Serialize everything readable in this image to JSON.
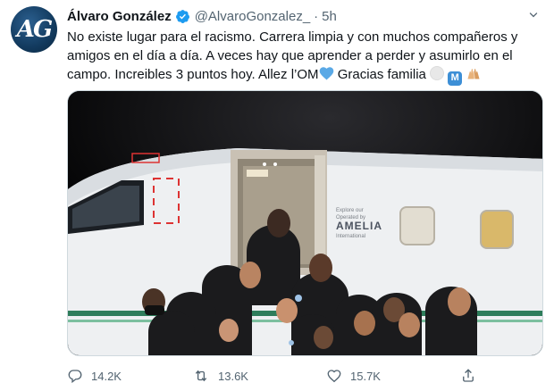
{
  "author": {
    "name": "Álvaro González",
    "handle": "@AlvaroGonzalez_",
    "separator": "·",
    "time": "5h",
    "avatar_initials": "AG"
  },
  "tweet": {
    "text_line1": "No existe lugar para el racismo. Carrera limpia y con muchos compañeros y",
    "text_line2": "amigos en el día a día. A veces hay que aprender a perder y asumirlo en el",
    "text_line3": "campo. Increibles 3 puntos hoy. Allez l’OM",
    "text_line3b": " Gracias familia",
    "emoji_m": "M"
  },
  "photo": {
    "plane_label_small": "Operated by",
    "plane_label_brand": "AMELIA",
    "plane_label_sub": "International"
  },
  "actions": {
    "reply_count": "14.2K",
    "retweet_count": "13.6K",
    "like_count": "15.7K"
  },
  "colors": {
    "verified": "#1d9bf0",
    "muted": "#536471",
    "heart_emoji": "#5aa9e6"
  },
  "icons": [
    "chevron-down-icon",
    "verified-badge-icon",
    "reply-icon",
    "retweet-icon",
    "like-icon",
    "share-icon"
  ]
}
